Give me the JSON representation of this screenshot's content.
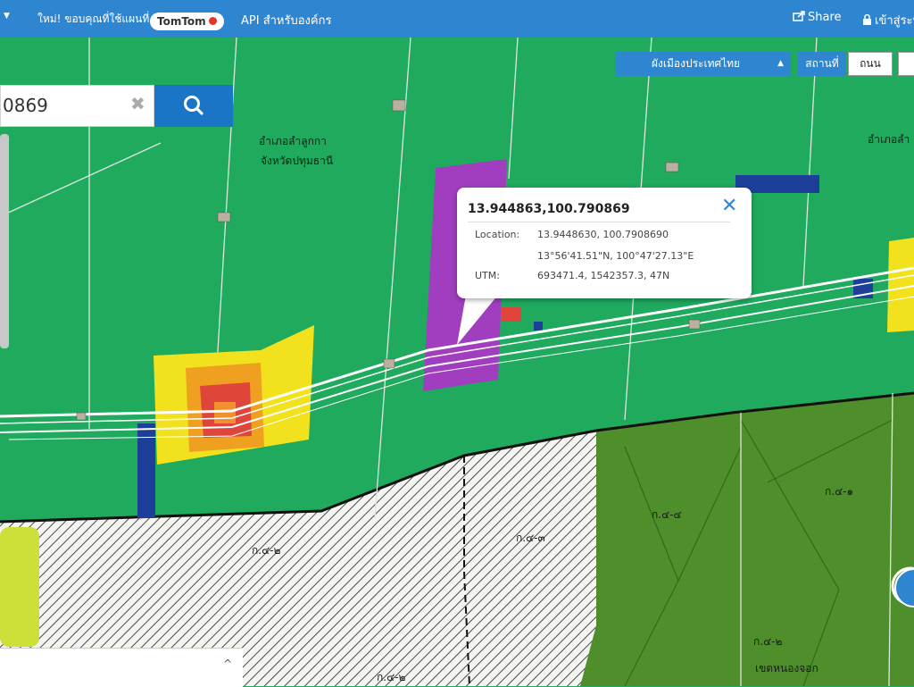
{
  "header": {
    "logo_text": "TomTom",
    "site_link": "ใหม่! ขอบคุณที่ใช้แผนที่",
    "api_link": "API สำหรับองค์กร",
    "share_label": "Share",
    "login_label": "เข้าสู่ระบบ"
  },
  "search": {
    "value": "0869",
    "clear_symbol": "✖"
  },
  "layer": {
    "selected": "ผังเมืองประเทศไทย",
    "view_label": "สถานที่",
    "view_option": "ถนน"
  },
  "popup": {
    "title": "13.944863,100.790869",
    "location_label": "Location:",
    "location_decimal": "13.9448630, 100.7908690",
    "location_dms": "13°56'41.51\"N, 100°47'27.13\"E",
    "utm_label": "UTM:",
    "utm_value": "693471.4, 1542357.3, 47N"
  },
  "map_labels": {
    "district_1": "อำเภอลำลูกกา",
    "province_1": "จังหวัดปทุมธานี",
    "district_2": "อำเภอลำ",
    "zone_1": "ก.๔-๒",
    "zone_2": "ก.๔-๓",
    "zone_3": "ก.๔-๔",
    "zone_4": "ก.๔-๑",
    "zone_5": "ก.๔-๒",
    "zone_6": "ก.๔-๒",
    "boundary_text": "เขตหนองจอก"
  },
  "colors": {
    "residential_green": "#1faa5e",
    "agri_olive": "#4e8f2c",
    "commercial_purple": "#a13ec0",
    "urban_yellow": "#f2e21d",
    "dense_orange": "#f0a020",
    "core_red": "#e0453c",
    "gov_blue": "#1d3f9a",
    "header_blue": "#2e86d1"
  }
}
